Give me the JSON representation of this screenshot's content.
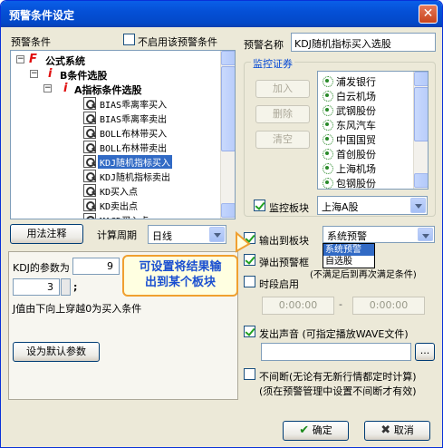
{
  "window": {
    "title": "预警条件设定",
    "close": "✕"
  },
  "left": {
    "conditions_label": "预警条件",
    "disable_label": "不启用该预警条件",
    "tree": {
      "root": "公式系统",
      "group": "B条件选股",
      "subgroup": "A指标条件选股",
      "items": [
        "BIAS乖离率买入",
        "BIAS乖离率卖出",
        "BOLL布林带买入",
        "BOLL布林带卖出",
        "KDJ随机指标买入",
        "KDJ随机指标卖出",
        "KD买入点",
        "KD卖出点",
        "MACD买入点"
      ],
      "selected_index": 4
    },
    "usage_button": "用法注释",
    "period_label": "计算周期",
    "period_value": "日线",
    "param_label": "KDJ的参数为",
    "param1": "9",
    "param2": "3",
    "param2_suffix": ";",
    "description": "J值由下向上穿越0为买入条件",
    "default_button": "设为默认参数"
  },
  "right": {
    "name_label": "预警名称",
    "name_value": "KDJ随机指标买入选股",
    "monitor_group": "监控证券",
    "add_button": "加入",
    "delete_button": "删除",
    "clear_button": "清空",
    "stocks": [
      "浦发银行",
      "白云机场",
      "武钢股份",
      "东风汽车",
      "中国国贸",
      "首创股份",
      "上海机场",
      "包钢股份"
    ],
    "monitor_board_label": "监控板块",
    "monitor_board_value": "上海A股",
    "output_label": "输出到板块",
    "output_value": "系统预警",
    "output_options": [
      "系统预警",
      "自选股"
    ],
    "popup_label": "弹出预警框",
    "popup_note": "(不满足后到再次满足条件)",
    "time_label": "时段启用",
    "time_start": "0:00:00",
    "time_dash": "-",
    "time_end": "0:00:00",
    "sound_label": "发出声音 (可指定播放WAVE文件)",
    "browse_button": "...",
    "continuous_label": "不间断(无论有无新行情都定时计算)",
    "continuous_note": "(须在预警管理中设置不间断才有效)",
    "ok_button": "确定",
    "cancel_button": "取消"
  },
  "tooltip": {
    "line1": "可设置将结果输",
    "line2": "出到某个板块"
  }
}
